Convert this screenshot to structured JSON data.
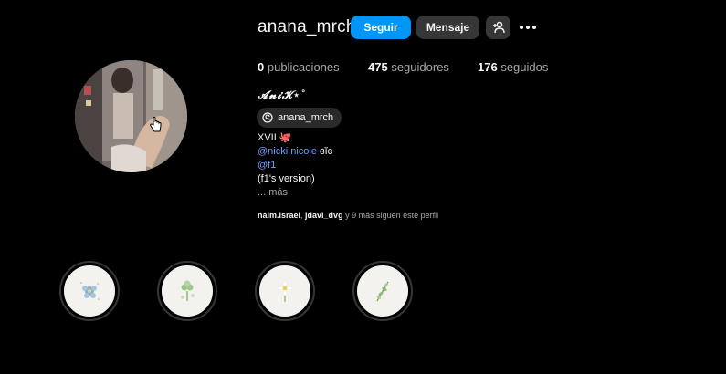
{
  "profile": {
    "username": "anana_mrch",
    "display_name": "𝓐𝓷𝓲𝓚⋆˚",
    "threads_handle": "anana_mrch"
  },
  "actions": {
    "follow_label": "Seguir",
    "message_label": "Mensaje",
    "suggest_icon": "add-person-icon",
    "more_icon": "more-dots-icon"
  },
  "stats": {
    "posts_count": "0",
    "posts_label": "publicaciones",
    "followers_count": "475",
    "followers_label": "seguidores",
    "following_count": "176",
    "following_label": "seguidos"
  },
  "bio": {
    "line1": "XVII",
    "line1_emoji": "🐙",
    "mention1": "@nicki.nicole",
    "mention1_suffix": "ɞĭɞ",
    "mention2": "@f1",
    "line4": "(f1's version)",
    "more": "... más"
  },
  "followed_by": {
    "user1": "naim.israel",
    "separator": ", ",
    "user2": "jdavi_dvg",
    "rest": " y 9 más siguen este perfil"
  },
  "highlights": [
    {
      "icon": "blue-flower-icon"
    },
    {
      "icon": "clover-icon"
    },
    {
      "icon": "daisy-icon"
    },
    {
      "icon": "leaf-sprig-icon"
    }
  ],
  "colors": {
    "background": "#000000",
    "follow_button": "#0095f6",
    "secondary_button": "#363636",
    "link": "#6f9cff"
  }
}
